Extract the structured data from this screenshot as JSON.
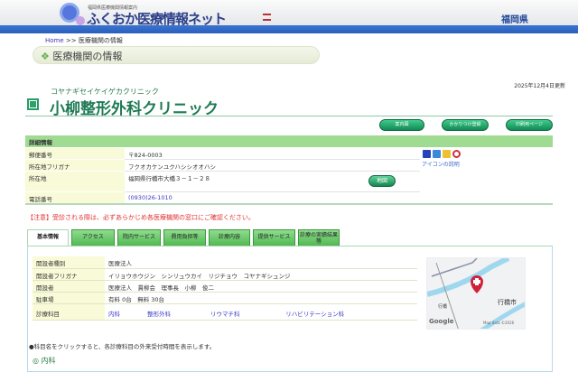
{
  "header": {
    "site_subtitle": "福岡県医療機関情報案内",
    "site_title": "ふくおか医療情報ネット",
    "prefecture": "福岡県"
  },
  "breadcrumb": {
    "home": "Home",
    "sep": ">>",
    "current": "医療機関の情報"
  },
  "section_title": "医療機関の情報",
  "updated": "2025年12月4日更新",
  "clinic": {
    "kana": "コヤナギセイケイゲカクリニック",
    "name": "小柳整形外科クリニック"
  },
  "buttons": {
    "guide_map": "案内図",
    "register": "かかりつけ登録",
    "print": "印刷用ページ",
    "map": "地図"
  },
  "details": {
    "header": "詳細情報",
    "rows": [
      {
        "label": "郵便番号",
        "value": "〒824-0003"
      },
      {
        "label": "所在地フリガナ",
        "value": "フクオカケンユクハシシオオハシ"
      },
      {
        "label": "所在地",
        "value": "福岡県行橋市大橋３－１－２８"
      },
      {
        "label": "電話番号",
        "value": "(0930)26-1010"
      }
    ],
    "icon_help": "アイコンの説明",
    "icons": [
      "parking-icon",
      "wheelchair-icon",
      "note-icon",
      "no-smoking-icon"
    ]
  },
  "warning": "【注意】受診される際は、必ずあらかじめ各医療機関の窓口にご確認ください。",
  "tabs": [
    "基本情報",
    "アクセス",
    "院内サービス",
    "費用負担等",
    "診療内容",
    "提供サービス",
    "診療の実績結果等"
  ],
  "basic": {
    "rows": [
      {
        "label": "開設者種別",
        "value": "医療法人"
      },
      {
        "label": "開設者フリガナ",
        "value": "イリョウホウジン　シンリュウカイ　リジチョウ　コヤナギシュンジ"
      },
      {
        "label": "開設者",
        "value": "医療法人　貫柳会　理事長　小柳　俊二"
      },
      {
        "label": "駐車場",
        "value": "有料 0台　無料 30台"
      }
    ],
    "departments_label": "診療科目",
    "departments": [
      "内科",
      "整形外科",
      "リウマチ科",
      "リハビリテーション科"
    ]
  },
  "map": {
    "place": "行橋市",
    "station": "行橋",
    "attribution": "Map data ©2026",
    "brand": "Google"
  },
  "note": "●科目名をクリックすると、各診療科目の外来受付時間を表示します。",
  "sub_heading": "◎ 内科"
}
